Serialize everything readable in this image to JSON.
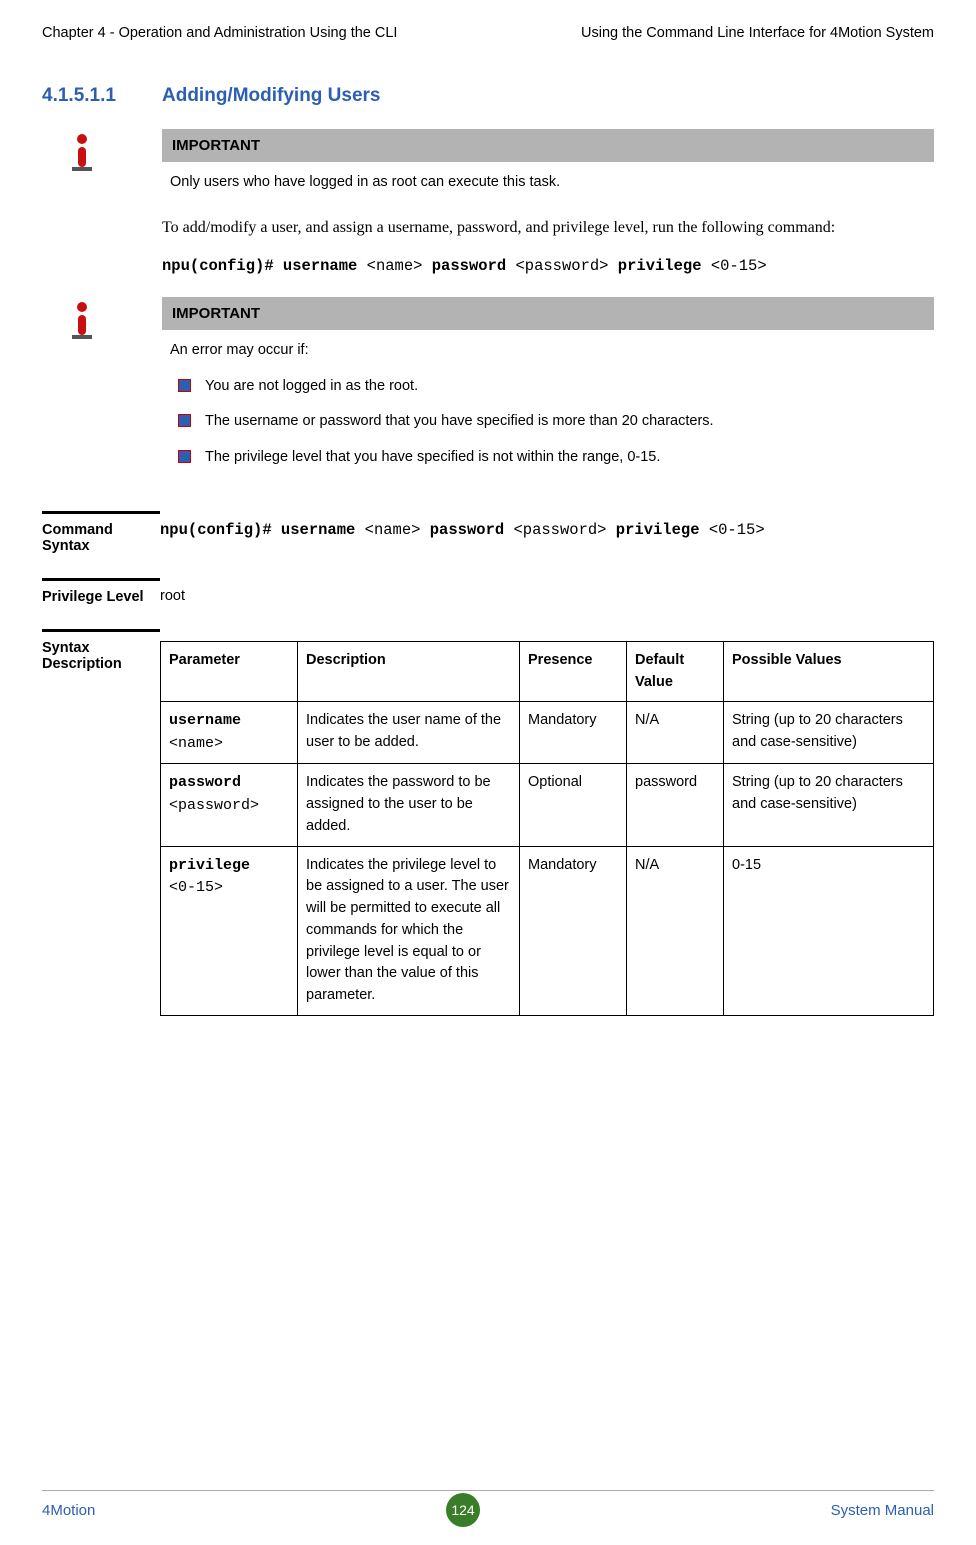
{
  "header": {
    "left": "Chapter 4 - Operation and Administration Using the CLI",
    "right": "Using the Command Line Interface for 4Motion System"
  },
  "section": {
    "number": "4.1.5.1.1",
    "title": "Adding/Modifying Users"
  },
  "important1": {
    "label": "IMPORTANT",
    "text": "Only users who have logged in as root can execute this task."
  },
  "intro_text": "To add/modify a user, and assign a username, password, and privilege level, run the following command:",
  "cmd": {
    "prefix": "npu(config)# username ",
    "arg1": "<name>",
    "mid1": " password ",
    "arg2": "<password>",
    "mid2": " privilege ",
    "arg3": "<0-15>"
  },
  "important2": {
    "label": "IMPORTANT",
    "intro": "An error may occur if:",
    "bullets": [
      "You are not logged in as the root.",
      "The username or password that you have specified is more than 20 characters.",
      "The privilege level that you have specified is not within the range, 0-15."
    ]
  },
  "rows": {
    "command_syntax_label": "Command Syntax",
    "privilege_level_label": "Privilege Level",
    "privilege_level_value": "root",
    "syntax_desc_label": "Syntax Description"
  },
  "table": {
    "headers": [
      "Parameter",
      "Description",
      "Presence",
      "Default Value",
      "Possible Values"
    ],
    "rows": [
      {
        "param_bold": "username",
        "param_arg": "<name>",
        "desc": "Indicates the user name of the user to be added.",
        "presence": "Mandatory",
        "default": "N/A",
        "possible": "String (up to 20 characters and case-sensitive)"
      },
      {
        "param_bold": "password",
        "param_arg": "<password>",
        "desc": "Indicates the password to be assigned to the user to be added.",
        "presence": "Optional",
        "default": "password",
        "possible": "String (up to 20 characters and case-sensitive)"
      },
      {
        "param_bold": "privilege",
        "param_arg": "<0-15>",
        "desc": "Indicates the privilege level to be assigned to a user. The user will be permitted to execute all commands for which the privilege level is equal to or lower than the value of this parameter.",
        "presence": "Mandatory",
        "default": "N/A",
        "possible": "0-15"
      }
    ]
  },
  "footer": {
    "left": "4Motion",
    "page": "124",
    "right": "System Manual"
  }
}
